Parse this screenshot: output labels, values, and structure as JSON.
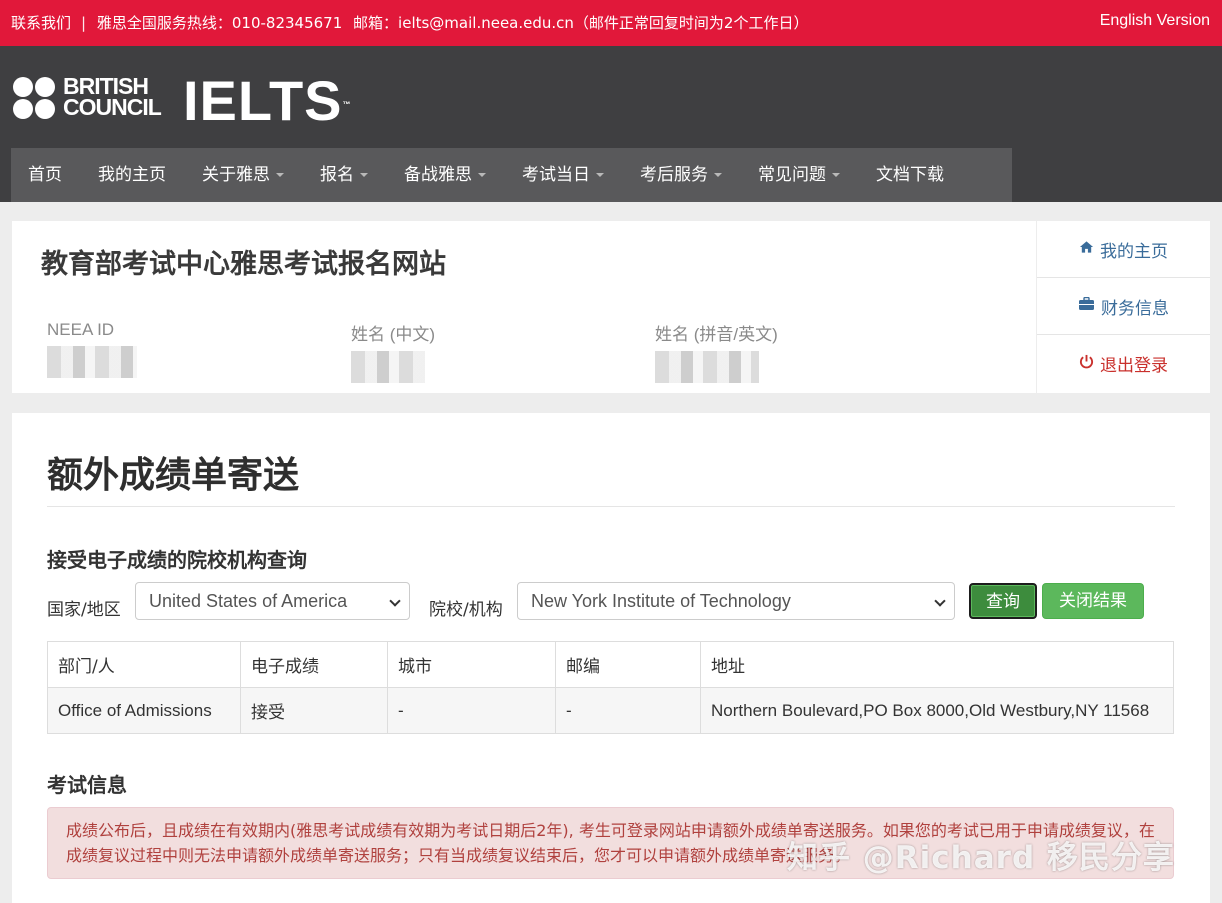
{
  "topbar": {
    "contact": "联系我们",
    "hotline": "雅思全国服务热线：010-82345671",
    "email": "邮箱：ielts@mail.neea.edu.cn（邮件正常回复时间为2个工作日）",
    "english_version": "English Version"
  },
  "header": {
    "bc_logo_line1": "BRITISH",
    "bc_logo_line2": "COUNCIL",
    "ielts_logo": "IELTS",
    "trademark": "™"
  },
  "nav": {
    "items": [
      {
        "label": "首页",
        "dropdown": false
      },
      {
        "label": "我的主页",
        "dropdown": false
      },
      {
        "label": "关于雅思",
        "dropdown": true
      },
      {
        "label": "报名",
        "dropdown": true
      },
      {
        "label": "备战雅思",
        "dropdown": true
      },
      {
        "label": "考试当日",
        "dropdown": true
      },
      {
        "label": "考后服务",
        "dropdown": true
      },
      {
        "label": "常见问题",
        "dropdown": true
      },
      {
        "label": "文档下载",
        "dropdown": false
      }
    ]
  },
  "profile": {
    "site_title": "教育部考试中心雅思考试报名网站",
    "fields": [
      {
        "label": "NEEA ID"
      },
      {
        "label": "姓名 (中文)"
      },
      {
        "label": "姓名 (拼音/英文)"
      }
    ]
  },
  "side_menu": {
    "items": [
      {
        "label": "我的主页",
        "icon": "home-icon"
      },
      {
        "label": "财务信息",
        "icon": "briefcase-icon"
      },
      {
        "label": "退出登录",
        "icon": "power-icon"
      }
    ]
  },
  "main": {
    "page_title": "额外成绩单寄送",
    "search_section_title": "接受电子成绩的院校机构查询",
    "country_label": "国家/地区",
    "country_value": "United States of America",
    "institution_label": "院校/机构",
    "institution_value": "New York Institute of Technology",
    "query_button": "查询",
    "close_button": "关闭结果",
    "table": {
      "headers": [
        "部门/人",
        "电子成绩",
        "城市",
        "邮编",
        "地址"
      ],
      "rows": [
        [
          "Office of Admissions",
          "接受",
          "-",
          "-",
          "Northern Boulevard,PO Box 8000,Old Westbury,NY 11568"
        ]
      ]
    },
    "exam_info_title": "考试信息",
    "alert_text": "成绩公布后，且成绩在有效期内(雅思考试成绩有效期为考试日期后2年), 考生可登录网站申请额外成绩单寄送服务。如果您的考试已用于申请成绩复议，在成绩复议过程中则无法申请额外成绩单寄送服务；只有当成绩复议结束后，您才可以申请额外成绩单寄送服务。"
  },
  "watermark": "知乎 @Richard 移民分享",
  "colors": {
    "topbar_red": "#e1183a",
    "header_dark": "#3f3f41",
    "nav_gray": "#59595b",
    "button_green": "#5cb85c",
    "alert_bg": "#f2dede",
    "alert_text": "#b0413e",
    "link_blue": "#3a6c9a",
    "logout_red": "#c9302c"
  }
}
